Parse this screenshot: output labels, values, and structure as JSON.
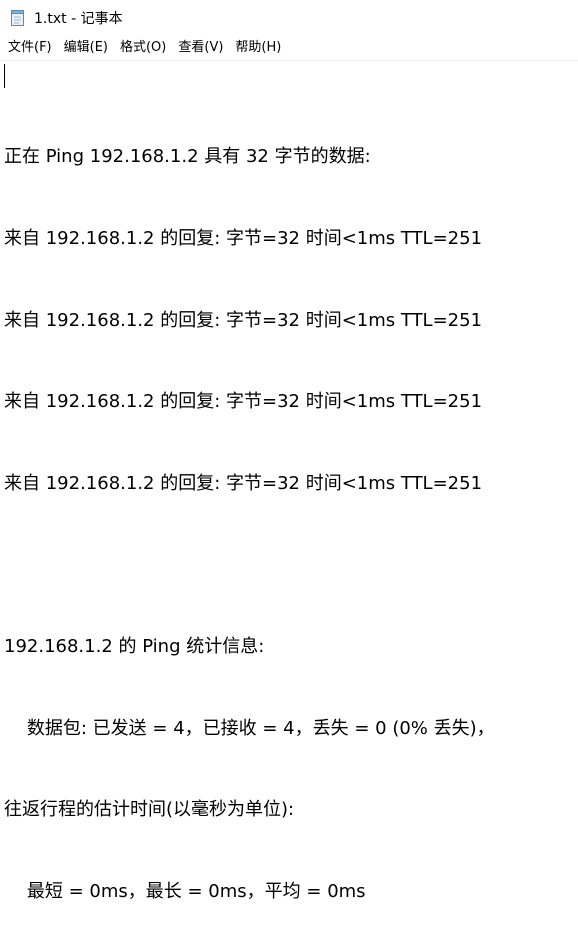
{
  "window": {
    "title": "1.txt - 记事本"
  },
  "menu": {
    "file": "文件(F)",
    "edit": "编辑(E)",
    "format": "格式(O)",
    "view": "查看(V)",
    "help": "帮助(H)"
  },
  "document": {
    "lines": [
      "正在 Ping 192.168.1.2 具有 32 字节的数据:",
      "来自 192.168.1.2 的回复: 字节=32 时间<1ms TTL=251",
      "来自 192.168.1.2 的回复: 字节=32 时间<1ms TTL=251",
      "来自 192.168.1.2 的回复: 字节=32 时间<1ms TTL=251",
      "来自 192.168.1.2 的回复: 字节=32 时间<1ms TTL=251",
      "",
      "192.168.1.2 的 Ping 统计信息:",
      "    数据包: 已发送 = 4，已接收 = 4，丢失 = 0 (0% 丢失)，",
      "往返行程的估计时间(以毫秒为单位):",
      "    最短 = 0ms，最长 = 0ms，平均 = 0ms"
    ]
  },
  "icons": {
    "app": "notepad-icon"
  }
}
